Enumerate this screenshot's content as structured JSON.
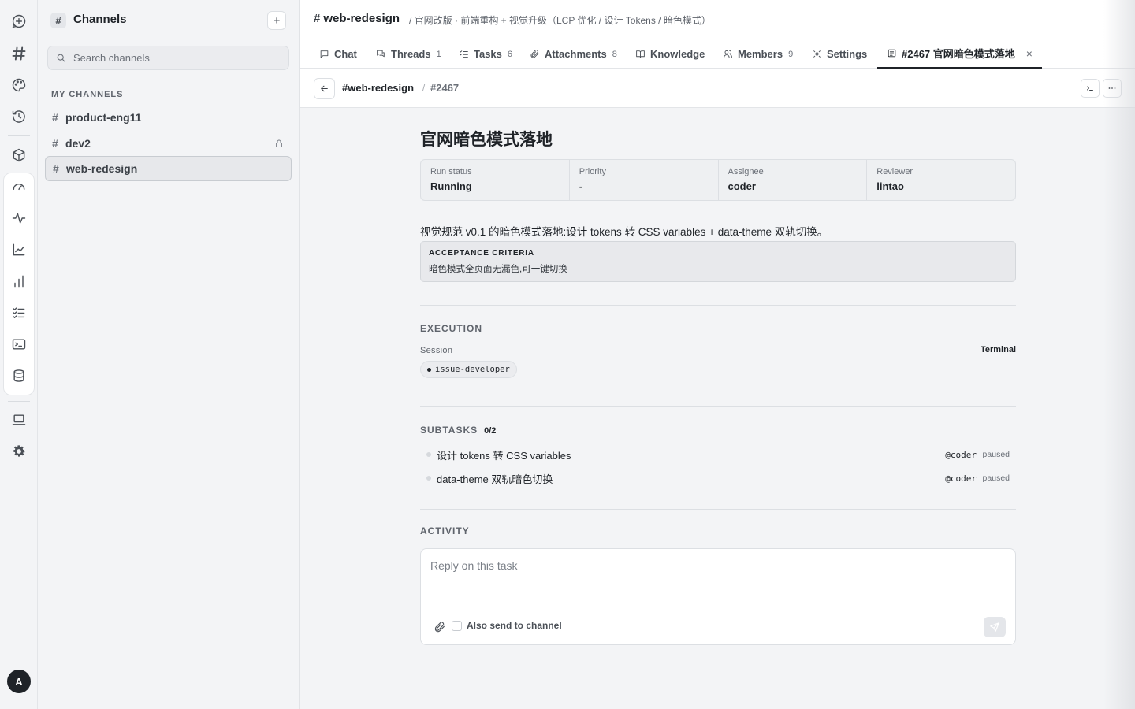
{
  "rail": {
    "icons": [
      "new-chat-icon",
      "channels-icon",
      "palette-icon",
      "history-icon",
      "cube-icon",
      "gauge-icon",
      "activity-icon",
      "line-chart-icon",
      "bar-chart-icon",
      "checklist-icon",
      "terminal-icon",
      "database-icon",
      "laptop-icon",
      "gear-icon"
    ],
    "avatar": "A"
  },
  "sidebar": {
    "title": "Channels",
    "add": "+",
    "search_placeholder": "Search channels",
    "section": "MY CHANNELS",
    "channels": [
      {
        "name": "product-eng11",
        "locked": false,
        "active": false
      },
      {
        "name": "dev2",
        "locked": true,
        "active": false
      },
      {
        "name": "web-redesign",
        "locked": false,
        "active": true
      }
    ]
  },
  "topbar": {
    "hash": "#",
    "channel": "web-redesign",
    "description": "/  官网改版 · 前端重构 + 视觉升级（LCP 优化 / 设计 Tokens / 暗色模式）"
  },
  "tabs": [
    {
      "label": "Chat",
      "count": ""
    },
    {
      "label": "Threads",
      "count": "1"
    },
    {
      "label": "Tasks",
      "count": "6"
    },
    {
      "label": "Attachments",
      "count": "8"
    },
    {
      "label": "Knowledge",
      "count": ""
    },
    {
      "label": "Members",
      "count": "9"
    },
    {
      "label": "Settings",
      "count": ""
    },
    {
      "label": "#2467 官网暗色模式落地",
      "count": "",
      "close": "×"
    }
  ],
  "breadcrumb": {
    "channel": "#web-redesign",
    "separator": "/",
    "id": "#2467"
  },
  "task": {
    "title": "官网暗色模式落地",
    "meta": [
      {
        "label": "Run status",
        "value": "Running"
      },
      {
        "label": "Priority",
        "value": "-"
      },
      {
        "label": "Assignee",
        "value": "coder"
      },
      {
        "label": "Reviewer",
        "value": "lintao"
      }
    ],
    "summary": "视觉规范 v0.1 的暗色模式落地:设计 tokens 转 CSS variables + data-theme 双轨切换。",
    "acceptance_title": "ACCEPTANCE CRITERIA",
    "acceptance_text": "暗色模式全页面无漏色,可一键切换",
    "execution": {
      "title": "EXECUTION",
      "session_label": "Session",
      "terminal": "Terminal",
      "session": "issue-developer"
    },
    "subtasks": {
      "title": "SUBTASKS",
      "count": "0/2",
      "items": [
        {
          "text": "设计 tokens 转 CSS variables",
          "assignee": "@coder",
          "status": "paused"
        },
        {
          "text": "data-theme 双轨暗色切换",
          "assignee": "@coder",
          "status": "paused"
        }
      ]
    },
    "activity": {
      "title": "ACTIVITY",
      "placeholder": "Reply on this task",
      "also_send": "Also send to channel"
    }
  }
}
